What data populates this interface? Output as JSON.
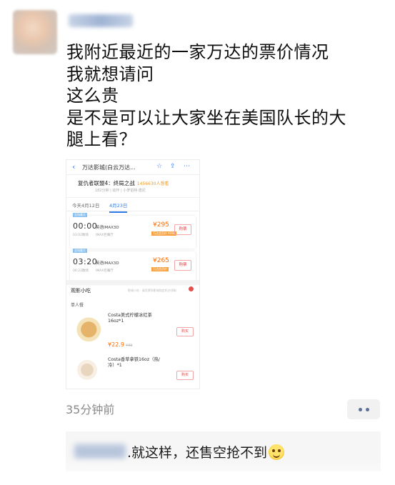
{
  "post": {
    "lines": [
      "我附近最近的一家万达的票价情况",
      "我就想请问",
      "这么贵",
      "是不是可以让大家坐在美国队长的大",
      "腿上看？"
    ],
    "time_ago": "35分钟前"
  },
  "screenshot": {
    "nav_title": "万达影城(白云万达...",
    "movie_title": "复仇者联盟4：终局之战",
    "want_count": "1456630人想看",
    "movie_info": "182分钟 | 动作 | 小罗伯特·唐尼",
    "dates": [
      "今天4月12日",
      "4月23日"
    ],
    "showtimes": [
      {
        "tag": "全场最大",
        "time": "00:00",
        "end": "03:02散场",
        "lang": "英语IMAX3D",
        "hall": "IMAX巨幕厅",
        "price": "¥295",
        "discount": "万达会员价 ¥284",
        "buy": "购票"
      },
      {
        "tag": "全场最大",
        "time": "03:20",
        "end": "06:22散场",
        "lang": "英语IMAX3D",
        "hall": "IMAX巨幕厅",
        "price": "¥265",
        "discount": "万达会员价",
        "buy": "购票"
      }
    ],
    "snacks": {
      "heading": "观影小吃",
      "hint": "影城小吃 · 请凭票到影城指定柜台领取",
      "single": "单人餐",
      "items": [
        {
          "name1": "Costa美式柠檬冰红茶",
          "name2": "16oz*1",
          "price": "¥22.9",
          "orig": "¥30",
          "buy": "购买"
        },
        {
          "name1": "Costa香草拿铁16oz（热/",
          "name2": "冷）*1",
          "buy": "购买"
        }
      ]
    }
  },
  "comment": {
    "text": ".就这样，还售空抢不到"
  }
}
